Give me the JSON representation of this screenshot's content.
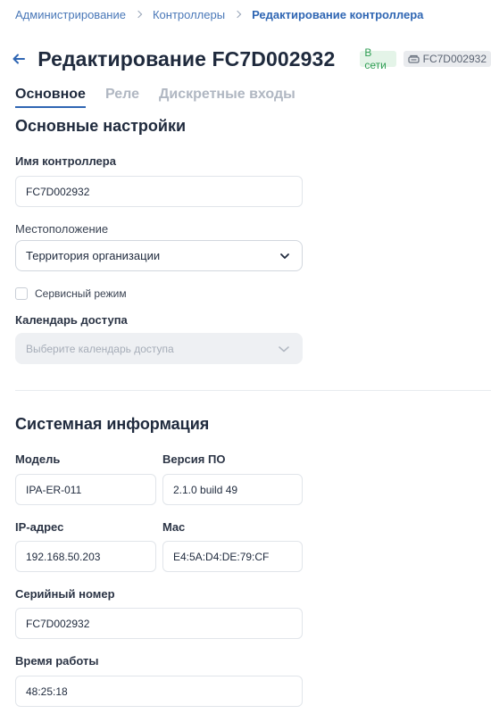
{
  "breadcrumb": {
    "items": [
      "Администрирование",
      "Контроллеры"
    ],
    "current": "Редактирование контроллера"
  },
  "header": {
    "title": "Редактирование FC7D002932",
    "status": "В сети",
    "serial_badge": "FC7D002932"
  },
  "tabs": [
    "Основное",
    "Реле",
    "Дискретные входы"
  ],
  "basic": {
    "section_title": "Основные настройки",
    "name_label": "Имя контроллера",
    "name_value": "FC7D002932",
    "location_label": "Местоположение",
    "location_value": "Территория организации",
    "service_mode_label": "Сервисный режим",
    "calendar_label": "Календарь доступа",
    "calendar_placeholder": "Выберите календарь доступа"
  },
  "system": {
    "section_title": "Системная информация",
    "model_label": "Модель",
    "model_value": "IPA-ER-011",
    "firmware_label": "Версия ПО",
    "firmware_value": "2.1.0 build 49",
    "ip_label": "IP-адрес",
    "ip_value": "192.168.50.203",
    "mac_label": "Mac",
    "mac_value": "E4:5A:D4:DE:79:CF",
    "serial_label": "Серийный номер",
    "serial_value": "FC7D002932",
    "uptime_label": "Время работы",
    "uptime_value": "48:25:18"
  },
  "colors": {
    "accent": "#2f66b3",
    "online": "#2f9e54"
  }
}
